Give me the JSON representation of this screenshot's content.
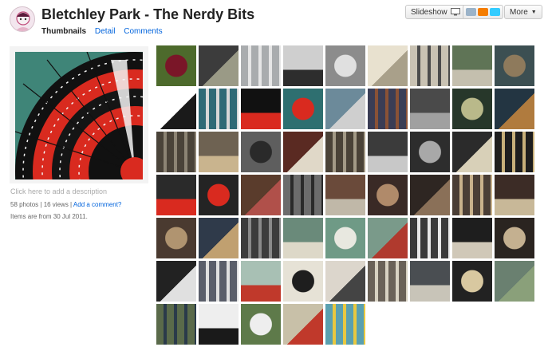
{
  "set": {
    "title": "Bletchley Park - The Nerdy Bits",
    "tabs": [
      {
        "label": "Thumbnails",
        "active": true
      },
      {
        "label": "Detail",
        "active": false
      },
      {
        "label": "Comments",
        "active": false
      }
    ]
  },
  "toolbar": {
    "slideshow_label": "Slideshow",
    "share_icons": [
      "email-icon",
      "blogger-icon",
      "twitter-icon"
    ],
    "more_label": "More"
  },
  "sidebar": {
    "description_placeholder": "Click here to add a description",
    "photos_count": "58 photos",
    "views_count": "16 views",
    "separator": "|",
    "add_comment_label": "Add a comment?",
    "date_text": "Items are from 30 Jul 2011."
  },
  "colors": {
    "link": "#0063dc",
    "cover_background": "#3f8578",
    "cover_red": "#d92a1f"
  },
  "thumbnails": [
    {
      "bg": "#4d6a2c",
      "accent": "#7a1628"
    },
    {
      "bg": "#3c3c3c",
      "accent": "#9a9a86"
    },
    {
      "bg": "#a9acae",
      "accent": "#e6e6e6"
    },
    {
      "bg": "#cfcfcf",
      "accent": "#2d2d2d"
    },
    {
      "bg": "#8c8c8c",
      "accent": "#e0e0e0"
    },
    {
      "bg": "#e8e1cf",
      "accent": "#a9a08a"
    },
    {
      "bg": "#c9c2b3",
      "accent": "#4b4b4b"
    },
    {
      "bg": "#5f7456",
      "accent": "#c4bfae"
    },
    {
      "bg": "#3c4f52",
      "accent": "#8e7a5c"
    },
    {
      "bg": "#ffffff",
      "accent": "#1a1a1a"
    },
    {
      "bg": "#2f6a76",
      "accent": "#d7d7d7"
    },
    {
      "bg": "#111111",
      "accent": "#d92a1f"
    },
    {
      "bg": "#2e6f70",
      "accent": "#d92a1f"
    },
    {
      "bg": "#6c8a9a",
      "accent": "#cfcfcf"
    },
    {
      "bg": "#3a3d55",
      "accent": "#8a5236"
    },
    {
      "bg": "#4a4a4a",
      "accent": "#a0a0a0"
    },
    {
      "bg": "#27372a",
      "accent": "#b9b98a"
    },
    {
      "bg": "#233542",
      "accent": "#b07b3e"
    },
    {
      "bg": "#4a4339",
      "accent": "#8c8474"
    },
    {
      "bg": "#6e6252",
      "accent": "#c9b48e"
    },
    {
      "bg": "#5e5e5e",
      "accent": "#2a2a2a"
    },
    {
      "bg": "#5a2a22",
      "accent": "#e0d8c8"
    },
    {
      "bg": "#4a4237",
      "accent": "#a39a86"
    },
    {
      "bg": "#3b3b3b",
      "accent": "#c8c8c8"
    },
    {
      "bg": "#2d2d2d",
      "accent": "#a8a8a8"
    },
    {
      "bg": "#2b2b2b",
      "accent": "#d8d0b8"
    },
    {
      "bg": "#1e1e1e",
      "accent": "#c8b07a"
    },
    {
      "bg": "#2a2a2a",
      "accent": "#d92a1f"
    },
    {
      "bg": "#242424",
      "accent": "#d92a1f"
    },
    {
      "bg": "#5a3c2c",
      "accent": "#b0504a"
    },
    {
      "bg": "#6c6c6c",
      "accent": "#2a2a2a"
    },
    {
      "bg": "#6a4a3a",
      "accent": "#c0b8a8"
    },
    {
      "bg": "#3a2a26",
      "accent": "#b08a6a"
    },
    {
      "bg": "#2e2622",
      "accent": "#8a7058"
    },
    {
      "bg": "#4a3e36",
      "accent": "#c9b28c"
    },
    {
      "bg": "#3c2c26",
      "accent": "#c8b898"
    },
    {
      "bg": "#4a3a30",
      "accent": "#b09470"
    },
    {
      "bg": "#2f3a4a",
      "accent": "#c0a070"
    },
    {
      "bg": "#3c3c3c",
      "accent": "#8a8a8a"
    },
    {
      "bg": "#6a8a7a",
      "accent": "#ddd8c8"
    },
    {
      "bg": "#6f9a86",
      "accent": "#e8e8e0"
    },
    {
      "bg": "#7a9a8a",
      "accent": "#b03a2e"
    },
    {
      "bg": "#3a3a3a",
      "accent": "#e8e8e8"
    },
    {
      "bg": "#1e1e1e",
      "accent": "#d0c8b8"
    },
    {
      "bg": "#2a2420",
      "accent": "#c4b090"
    },
    {
      "bg": "#222222",
      "accent": "#e0e0e0"
    },
    {
      "bg": "#5a5e6a",
      "accent": "#e0e0e0"
    },
    {
      "bg": "#a8c0b4",
      "accent": "#c0392b"
    },
    {
      "bg": "#e6e2d6",
      "accent": "#1e1e1e"
    },
    {
      "bg": "#dcd6cc",
      "accent": "#444444"
    },
    {
      "bg": "#6a6258",
      "accent": "#d8d2c2"
    },
    {
      "bg": "#4a4e52",
      "accent": "#c8c4b8"
    },
    {
      "bg": "#222222",
      "accent": "#d8c8a0"
    },
    {
      "bg": "#6a8070",
      "accent": "#8aa07a"
    },
    {
      "bg": "#5a6a4a",
      "accent": "#2a3a4a"
    },
    {
      "bg": "#eeeeee",
      "accent": "#1a1a1a"
    },
    {
      "bg": "#5e7a4a",
      "accent": "#eeeeee"
    },
    {
      "bg": "#c8c0a8",
      "accent": "#c0392b"
    },
    {
      "bg": "#5aa0b0",
      "accent": "#e8c840"
    }
  ]
}
